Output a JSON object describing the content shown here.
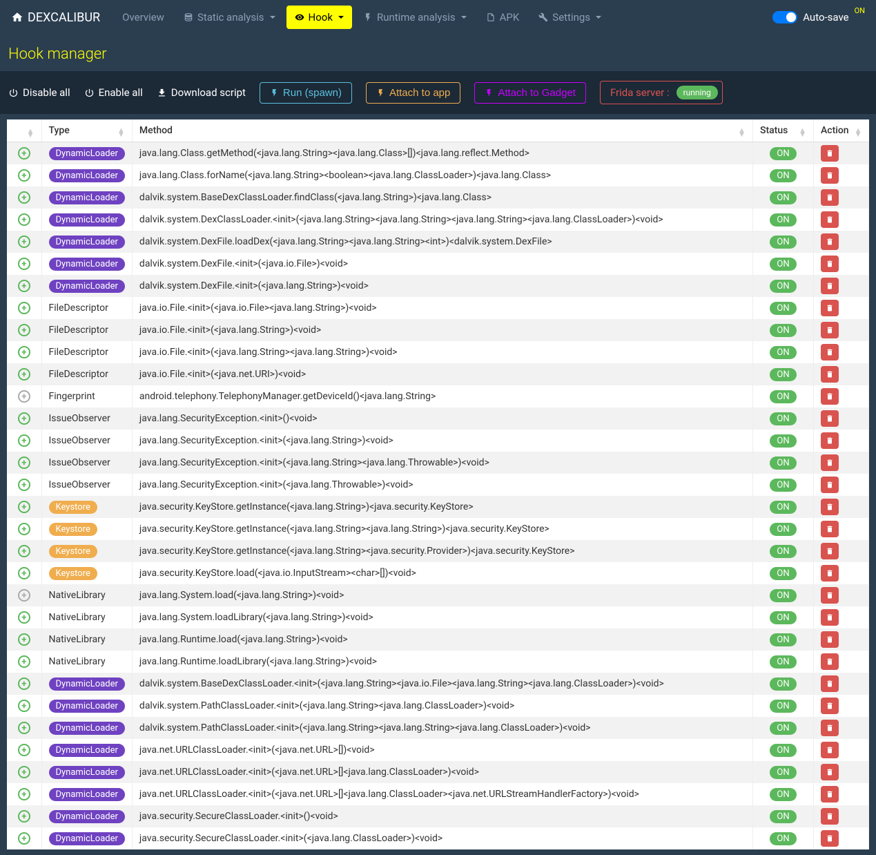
{
  "brand": "DEXCALIBUR",
  "nav": {
    "overview": "Overview",
    "static": "Static analysis",
    "hook": "Hook",
    "runtime": "Runtime analysis",
    "apk": "APK",
    "settings": "Settings"
  },
  "autosave": {
    "label": "Auto-save",
    "status": "ON"
  },
  "page_title": "Hook manager",
  "toolbar": {
    "disable_all": "Disable all",
    "enable_all": "Enable all",
    "download": "Download script",
    "run": "Run (spawn)",
    "attach_app": "Attach to app",
    "attach_gadget": "Attach to Gadget",
    "frida_label": "Frida server :",
    "frida_status": "running"
  },
  "columns": {
    "type": "Type",
    "method": "Method",
    "status": "Status",
    "action": "Action"
  },
  "rows": [
    {
      "expand": "plus",
      "type": "DynamicLoader",
      "type_style": "dynamic",
      "method": "java.lang.Class.getMethod(<java.lang.String><java.lang.Class>[])<java.lang.reflect.Method>",
      "status": "ON"
    },
    {
      "expand": "plus",
      "type": "DynamicLoader",
      "type_style": "dynamic",
      "method": "java.lang.Class.forName(<java.lang.String><boolean><java.lang.ClassLoader>)<java.lang.Class>",
      "status": "ON"
    },
    {
      "expand": "plus",
      "type": "DynamicLoader",
      "type_style": "dynamic",
      "method": "dalvik.system.BaseDexClassLoader.findClass(<java.lang.String>)<java.lang.Class>",
      "status": "ON"
    },
    {
      "expand": "plus",
      "type": "DynamicLoader",
      "type_style": "dynamic",
      "method": "dalvik.system.DexClassLoader.<init>(<java.lang.String><java.lang.String><java.lang.String><java.lang.ClassLoader>)<void>",
      "status": "ON"
    },
    {
      "expand": "plus",
      "type": "DynamicLoader",
      "type_style": "dynamic",
      "method": "dalvik.system.DexFile.loadDex(<java.lang.String><java.lang.String><int>)<dalvik.system.DexFile>",
      "status": "ON"
    },
    {
      "expand": "plus",
      "type": "DynamicLoader",
      "type_style": "dynamic",
      "method": "dalvik.system.DexFile.<init>(<java.io.File>)<void>",
      "status": "ON"
    },
    {
      "expand": "plus",
      "type": "DynamicLoader",
      "type_style": "dynamic",
      "method": "dalvik.system.DexFile.<init>(<java.lang.String>)<void>",
      "status": "ON"
    },
    {
      "expand": "plus",
      "type": "FileDescriptor",
      "type_style": "plain",
      "method": "java.io.File.<init>(<java.io.File><java.lang.String>)<void>",
      "status": "ON"
    },
    {
      "expand": "plus",
      "type": "FileDescriptor",
      "type_style": "plain",
      "method": "java.io.File.<init>(<java.lang.String>)<void>",
      "status": "ON"
    },
    {
      "expand": "plus",
      "type": "FileDescriptor",
      "type_style": "plain",
      "method": "java.io.File.<init>(<java.lang.String><java.lang.String>)<void>",
      "status": "ON"
    },
    {
      "expand": "plus",
      "type": "FileDescriptor",
      "type_style": "plain",
      "method": "java.io.File.<init>(<java.net.URI>)<void>",
      "status": "ON"
    },
    {
      "expand": "disabled",
      "type": "Fingerprint",
      "type_style": "plain",
      "method": "android.telephony.TelephonyManager.getDeviceId()<java.lang.String>",
      "status": "ON"
    },
    {
      "expand": "plus",
      "type": "IssueObserver",
      "type_style": "plain",
      "method": "java.lang.SecurityException.<init>()<void>",
      "status": "ON"
    },
    {
      "expand": "plus",
      "type": "IssueObserver",
      "type_style": "plain",
      "method": "java.lang.SecurityException.<init>(<java.lang.String>)<void>",
      "status": "ON"
    },
    {
      "expand": "plus",
      "type": "IssueObserver",
      "type_style": "plain",
      "method": "java.lang.SecurityException.<init>(<java.lang.String><java.lang.Throwable>)<void>",
      "status": "ON"
    },
    {
      "expand": "plus",
      "type": "IssueObserver",
      "type_style": "plain",
      "method": "java.lang.SecurityException.<init>(<java.lang.Throwable>)<void>",
      "status": "ON"
    },
    {
      "expand": "plus",
      "type": "Keystore",
      "type_style": "keystore",
      "method": "java.security.KeyStore.getInstance(<java.lang.String>)<java.security.KeyStore>",
      "status": "ON"
    },
    {
      "expand": "plus",
      "type": "Keystore",
      "type_style": "keystore",
      "method": "java.security.KeyStore.getInstance(<java.lang.String><java.lang.String>)<java.security.KeyStore>",
      "status": "ON"
    },
    {
      "expand": "plus",
      "type": "Keystore",
      "type_style": "keystore",
      "method": "java.security.KeyStore.getInstance(<java.lang.String><java.security.Provider>)<java.security.KeyStore>",
      "status": "ON"
    },
    {
      "expand": "plus",
      "type": "Keystore",
      "type_style": "keystore",
      "method": "java.security.KeyStore.load(<java.io.InputStream><char>[])<void>",
      "status": "ON"
    },
    {
      "expand": "disabled",
      "type": "NativeLibrary",
      "type_style": "plain",
      "method": "java.lang.System.load(<java.lang.String>)<void>",
      "status": "ON"
    },
    {
      "expand": "plus",
      "type": "NativeLibrary",
      "type_style": "plain",
      "method": "java.lang.System.loadLibrary(<java.lang.String>)<void>",
      "status": "ON"
    },
    {
      "expand": "plus",
      "type": "NativeLibrary",
      "type_style": "plain",
      "method": "java.lang.Runtime.load(<java.lang.String>)<void>",
      "status": "ON"
    },
    {
      "expand": "plus",
      "type": "NativeLibrary",
      "type_style": "plain",
      "method": "java.lang.Runtime.loadLibrary(<java.lang.String>)<void>",
      "status": "ON"
    },
    {
      "expand": "plus",
      "type": "DynamicLoader",
      "type_style": "dynamic",
      "method": "dalvik.system.BaseDexClassLoader.<init>(<java.lang.String><java.io.File><java.lang.String><java.lang.ClassLoader>)<void>",
      "status": "ON"
    },
    {
      "expand": "plus",
      "type": "DynamicLoader",
      "type_style": "dynamic",
      "method": "dalvik.system.PathClassLoader.<init>(<java.lang.String><java.lang.ClassLoader>)<void>",
      "status": "ON"
    },
    {
      "expand": "plus",
      "type": "DynamicLoader",
      "type_style": "dynamic",
      "method": "dalvik.system.PathClassLoader.<init>(<java.lang.String><java.lang.String><java.lang.ClassLoader>)<void>",
      "status": "ON"
    },
    {
      "expand": "plus",
      "type": "DynamicLoader",
      "type_style": "dynamic",
      "method": "java.net.URLClassLoader.<init>(<java.net.URL>[])<void>",
      "status": "ON"
    },
    {
      "expand": "plus",
      "type": "DynamicLoader",
      "type_style": "dynamic",
      "method": "java.net.URLClassLoader.<init>(<java.net.URL>[]<java.lang.ClassLoader>)<void>",
      "status": "ON"
    },
    {
      "expand": "plus",
      "type": "DynamicLoader",
      "type_style": "dynamic",
      "method": "java.net.URLClassLoader.<init>(<java.net.URL>[]<java.lang.ClassLoader><java.net.URLStreamHandlerFactory>)<void>",
      "status": "ON"
    },
    {
      "expand": "plus",
      "type": "DynamicLoader",
      "type_style": "dynamic",
      "method": "java.security.SecureClassLoader.<init>()<void>",
      "status": "ON"
    },
    {
      "expand": "plus",
      "type": "DynamicLoader",
      "type_style": "dynamic",
      "method": "java.security.SecureClassLoader.<init>(<java.lang.ClassLoader>)<void>",
      "status": "ON"
    }
  ]
}
